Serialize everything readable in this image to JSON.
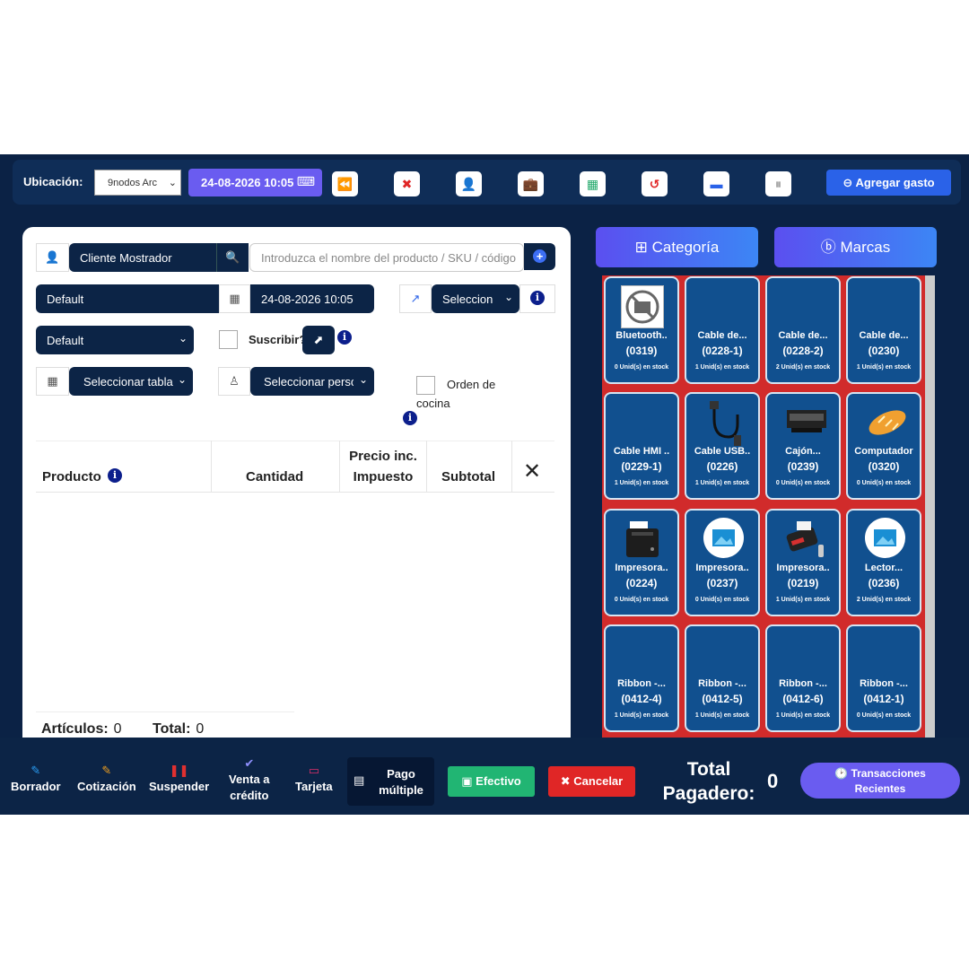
{
  "topbar": {
    "location_label": "Ubicación:",
    "location_value": "9nodos Arc",
    "datetime": "24-08-2026 10:05",
    "add_expense": "Agregar gasto"
  },
  "customer": {
    "name": "Cliente Mostrador",
    "search_placeholder": "Introduzca el nombre del producto / SKU / código"
  },
  "form": {
    "price_group": "Default",
    "date": "24-08-2026 10:05",
    "select_label": "Seleccion",
    "default_select": "Default",
    "subscribe_label": "Suscribir?",
    "table_select": "Seleccionar tabla",
    "person_select": "Seleccionar personal",
    "kitchen_order_line1": "Orden de",
    "kitchen_order_line2": "cocina"
  },
  "table": {
    "headers": {
      "product": "Producto",
      "quantity": "Cantidad",
      "price_line1": "Precio inc.",
      "price_line2": "Impuesto",
      "subtotal": "Subtotal",
      "remove": "✕"
    }
  },
  "summary": {
    "items_label": "Artículos:",
    "items_value": "0",
    "total_label": "Total:",
    "total_value": "0"
  },
  "catalog": {
    "category_label": "Categoría",
    "brands_label": "Marcas",
    "products": [
      {
        "name": "Bluetooth..",
        "code": "(0319)",
        "stock": "0 Unid(s) en stock",
        "img": "noimage"
      },
      {
        "name": "Cable de...",
        "code": "(0228-1)",
        "stock": "1 Unid(s) en stock",
        "img": "none"
      },
      {
        "name": "Cable de...",
        "code": "(0228-2)",
        "stock": "2 Unid(s) en stock",
        "img": "none"
      },
      {
        "name": "Cable de...",
        "code": "(0230)",
        "stock": "1 Unid(s) en stock",
        "img": "none"
      },
      {
        "name": "Cable HMI ..",
        "code": "(0229-1)",
        "stock": "1 Unid(s) en stock",
        "img": "none"
      },
      {
        "name": "Cable USB..",
        "code": "(0226)",
        "stock": "1 Unid(s) en stock",
        "img": "cable"
      },
      {
        "name": "Cajón...",
        "code": "(0239)",
        "stock": "0 Unid(s) en stock",
        "img": "drawer"
      },
      {
        "name": "Computador",
        "code": "(0320)",
        "stock": "0 Unid(s) en stock",
        "img": "bread"
      },
      {
        "name": "Impresora..",
        "code": "(0224)",
        "stock": "0 Unid(s) en stock",
        "img": "printer"
      },
      {
        "name": "Impresora..",
        "code": "(0237)",
        "stock": "0 Unid(s) en stock",
        "img": "placeholder"
      },
      {
        "name": "Impresora..",
        "code": "(0219)",
        "stock": "1 Unid(s) en stock",
        "img": "mobileprinter"
      },
      {
        "name": "Lector...",
        "code": "(0236)",
        "stock": "2 Unid(s) en stock",
        "img": "placeholder"
      },
      {
        "name": "Ribbon -...",
        "code": "(0412-4)",
        "stock": "1 Unid(s) en stock",
        "img": "none"
      },
      {
        "name": "Ribbon -...",
        "code": "(0412-5)",
        "stock": "1 Unid(s) en stock",
        "img": "none"
      },
      {
        "name": "Ribbon -...",
        "code": "(0412-6)",
        "stock": "1 Unid(s) en stock",
        "img": "none"
      },
      {
        "name": "Ribbon -...",
        "code": "(0412-1)",
        "stock": "0 Unid(s) en stock",
        "img": "none"
      }
    ]
  },
  "bottom": {
    "draft": "Borrador",
    "quote": "Cotización",
    "suspend": "Suspender",
    "credit_line1": "Venta a",
    "credit_line2": "crédito",
    "card": "Tarjeta",
    "multi_line1": "Pago",
    "multi_line2": "múltiple",
    "cash": "Efectivo",
    "cancel": "Cancelar",
    "total_line1": "Total",
    "total_line2": "Pagadero:",
    "total_value": "0",
    "recent_line1": "Transacciones",
    "recent_line2": "Recientes"
  },
  "colors": {
    "background": "#0b2245",
    "accent_purple": "#6a5cf0",
    "accent_blue": "#2a62e8",
    "grid_red": "#d12b2b",
    "tile_blue": "#11508f",
    "cash_green": "#21b573",
    "cancel_red": "#e02626"
  }
}
